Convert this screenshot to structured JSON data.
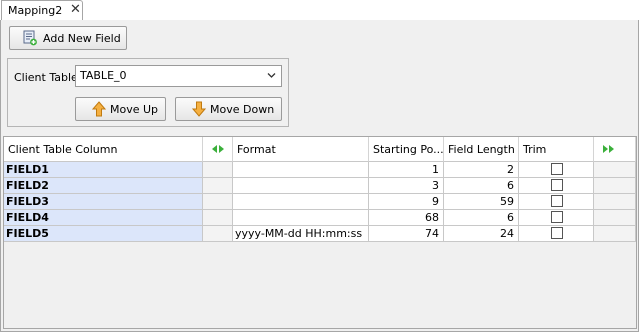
{
  "tab": {
    "title": "Mapping2",
    "close_glyph": "✕"
  },
  "toolbar": {
    "add_field_label": "Add New Field"
  },
  "client": {
    "label": "Client Table",
    "selected": "TABLE_0",
    "move_up_label": "Move Up",
    "move_down_label": "Move Down"
  },
  "table": {
    "headers": {
      "column": "Client Table Column",
      "format": "Format",
      "starting": "Starting Po...",
      "length": "Field Length",
      "trim": "Trim"
    },
    "rows": [
      {
        "name": "FIELD1",
        "format": "",
        "start": "1",
        "length": "2",
        "trim": false
      },
      {
        "name": "FIELD2",
        "format": "",
        "start": "3",
        "length": "6",
        "trim": false
      },
      {
        "name": "FIELD3",
        "format": "",
        "start": "9",
        "length": "59",
        "trim": false
      },
      {
        "name": "FIELD4",
        "format": "",
        "start": "68",
        "length": "6",
        "trim": false
      },
      {
        "name": "FIELD5",
        "format": "yyyy-MM-dd HH:mm:ss",
        "start": "74",
        "length": "24",
        "trim": false
      }
    ]
  },
  "icons": {
    "add": "add-field-icon",
    "up": "arrow-up-icon",
    "down": "arrow-down-icon",
    "expand_left_right": "expand-left-right-icon",
    "expand_right": "double-right-icon",
    "dropdown": "chevron-down-icon"
  },
  "colors": {
    "name_cell_bg": "#dce6fa",
    "arrow_orange": "#f0a030",
    "expand_green": "#3bb03b"
  }
}
